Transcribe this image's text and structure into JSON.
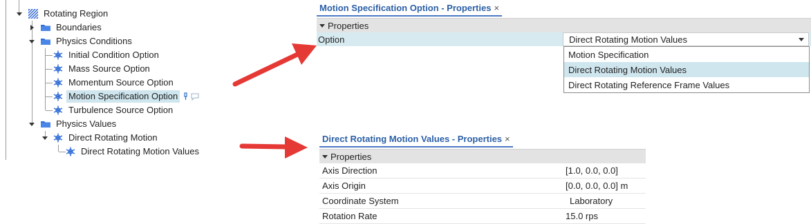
{
  "tree": {
    "nodes": [
      {
        "label": "Rotating Region",
        "icon": "rotating-region-icon"
      },
      {
        "label": "Boundaries",
        "icon": "folder-icon"
      },
      {
        "label": "Physics Conditions",
        "icon": "folder-icon"
      },
      {
        "label": "Initial Condition Option",
        "icon": "physics-option-icon"
      },
      {
        "label": "Mass Source Option",
        "icon": "physics-option-icon"
      },
      {
        "label": "Momentum Source Option",
        "icon": "physics-option-icon"
      },
      {
        "label": "Motion Specification Option",
        "icon": "physics-option-icon",
        "selected": true
      },
      {
        "label": "Turbulence Source Option",
        "icon": "physics-option-icon"
      },
      {
        "label": "Physics Values",
        "icon": "folder-icon"
      },
      {
        "label": "Direct Rotating Motion",
        "icon": "physics-option-icon"
      },
      {
        "label": "Direct Rotating Motion Values",
        "icon": "physics-option-icon"
      }
    ]
  },
  "panel1": {
    "title": "Motion Specification Option - Properties",
    "close": "×",
    "section": "Properties",
    "row": {
      "key": "Option",
      "value": "Direct Rotating Motion Values"
    },
    "options": [
      "Motion Specification",
      "Direct Rotating Motion Values",
      "Direct Rotating Reference Frame Values"
    ],
    "highlighted_option": "Direct Rotating Motion Values"
  },
  "panel2": {
    "title": "Direct Rotating Motion Values - Properties",
    "close": "×",
    "section": "Properties",
    "rows": [
      {
        "key": "Axis Direction",
        "value": "[1.0, 0.0, 0.0]"
      },
      {
        "key": "Axis Origin",
        "value": "[0.0, 0.0, 0.0] m"
      },
      {
        "key": "Coordinate System",
        "value": "Laboratory"
      },
      {
        "key": "Rotation Rate",
        "value": "15.0 rps"
      }
    ]
  },
  "colors": {
    "accent": "#2b5fa6",
    "selection": "#cfe6ee",
    "arrow": "#e53935"
  }
}
